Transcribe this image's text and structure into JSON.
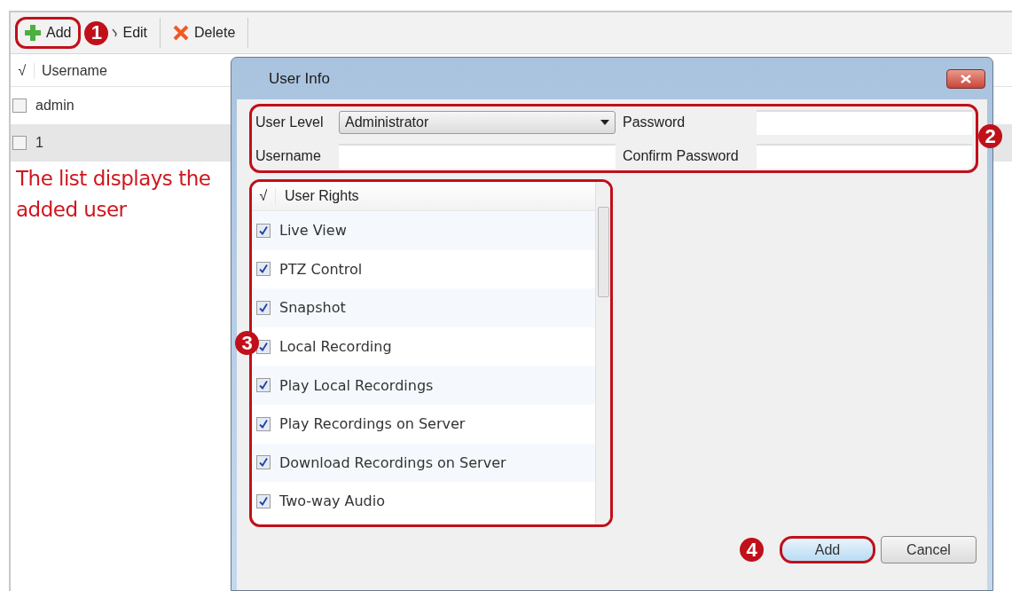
{
  "toolbar": {
    "buttons": [
      {
        "kind": "add",
        "label": "Add"
      },
      {
        "kind": "edit",
        "label": "Edit"
      },
      {
        "kind": "delete",
        "label": "Delete"
      }
    ]
  },
  "user_table": {
    "check_header": "√",
    "columns": [
      "Username"
    ],
    "rows": [
      {
        "username": "admin",
        "checked": false,
        "selected": false
      },
      {
        "username": "1",
        "checked": false,
        "selected": true
      }
    ]
  },
  "note": "The list displays the added user",
  "dialog": {
    "title": "User Info",
    "user_level": {
      "label": "User Level",
      "value": "Administrator"
    },
    "username": {
      "label": "Username"
    },
    "password": {
      "label": "Password"
    },
    "confirm_password": {
      "label": "Confirm Password"
    },
    "rights": {
      "check_header": "√",
      "column": "User Rights",
      "items": [
        {
          "label": "Live View",
          "checked": true
        },
        {
          "label": "PTZ Control",
          "checked": true
        },
        {
          "label": "Snapshot",
          "checked": true
        },
        {
          "label": "Local Recording",
          "checked": true
        },
        {
          "label": "Play Local Recordings",
          "checked": true
        },
        {
          "label": "Play Recordings on Server",
          "checked": true
        },
        {
          "label": "Download Recordings on Server",
          "checked": true
        },
        {
          "label": "Two-way Audio",
          "checked": true
        }
      ]
    },
    "buttons": [
      {
        "kind": "primary",
        "label": "Add"
      },
      {
        "kind": "secondary",
        "label": "Cancel"
      }
    ]
  },
  "callouts": [
    "1",
    "2",
    "3",
    "4"
  ]
}
